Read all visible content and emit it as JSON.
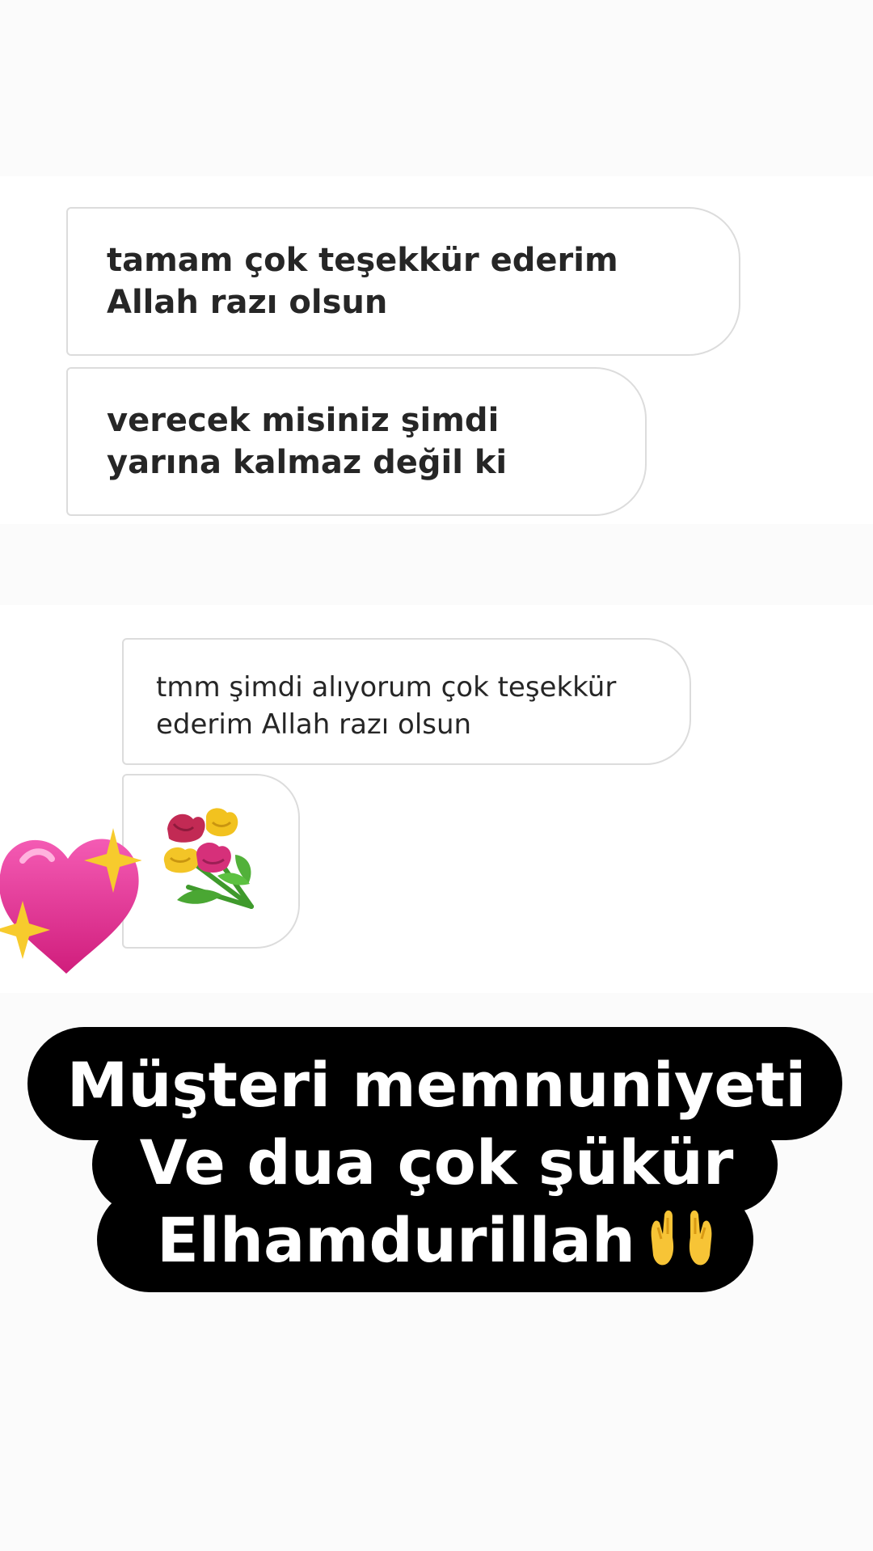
{
  "messages": [
    {
      "text": "tamam çok teşekkür ederim Allah razı olsun"
    },
    {
      "text": "verecek misiniz şimdi yarına kalmaz değil ki"
    },
    {
      "text": "tmm şimdi alıyorum çok teşekkür ederim Allah razı olsun"
    }
  ],
  "sticker_message": {
    "icon": "bouquet-icon"
  },
  "decorations": {
    "heart_icon": "sparkling-heart-icon",
    "heart_color": "#e0238c"
  },
  "caption": {
    "line1": "Müşteri memnuniyeti",
    "line2": "Ve dua çok şükür",
    "line3": "Elhamdurillah",
    "emoji": "raised-hands-icon",
    "background_color": "#000000",
    "text_color": "#ffffff"
  }
}
